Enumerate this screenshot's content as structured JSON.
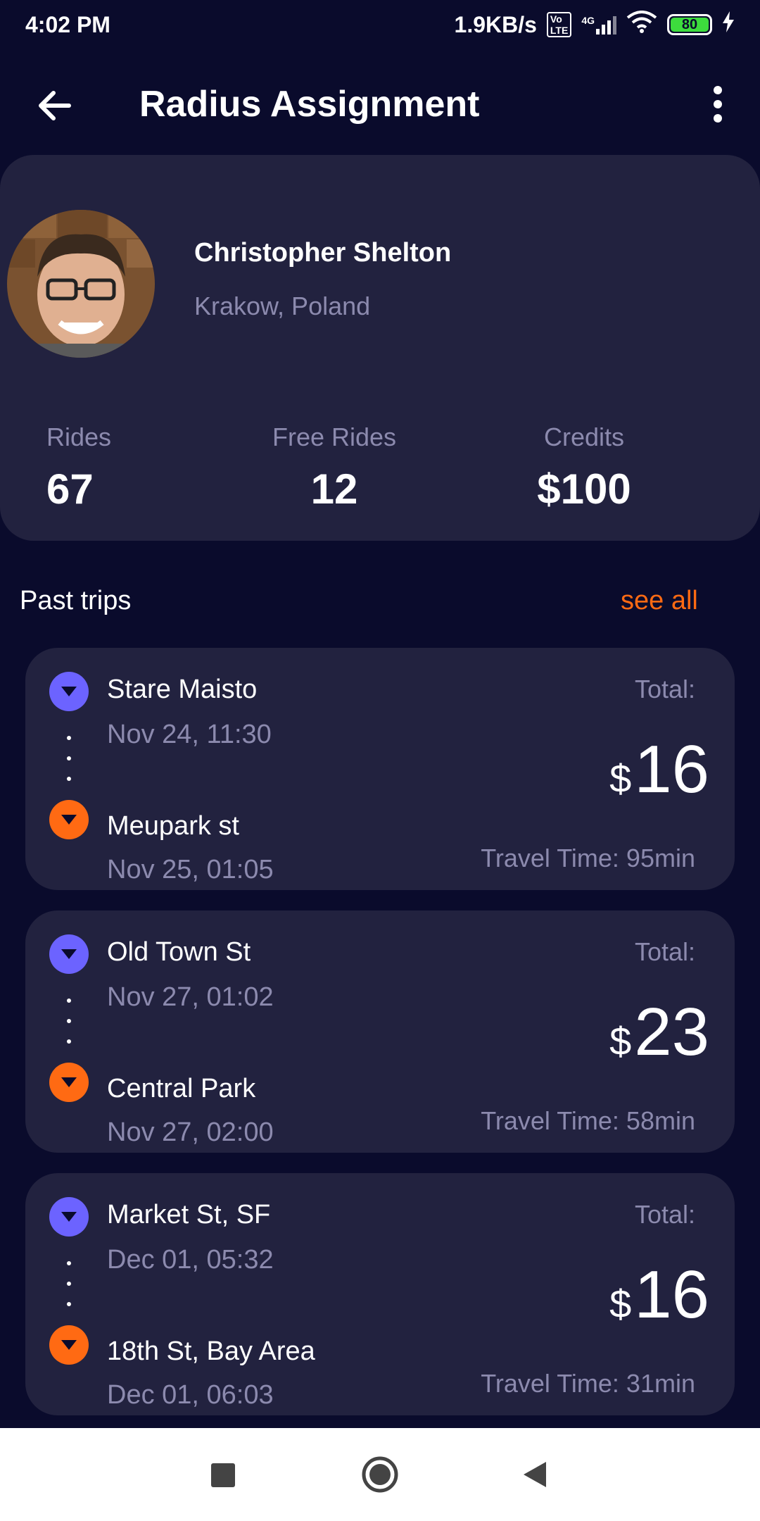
{
  "status_bar": {
    "time": "4:02 PM",
    "network_speed": "1.9KB/s",
    "volte": "Vo LTE",
    "network_type": "4G",
    "battery": "80",
    "icons": [
      "volte-icon",
      "signal-icon",
      "wifi-icon",
      "battery-icon",
      "charging-icon"
    ]
  },
  "header": {
    "title": "Radius Assignment",
    "back_icon": "arrow-left-icon",
    "more_icon": "more-vertical-icon"
  },
  "profile": {
    "name": "Christopher Shelton",
    "location": "Krakow, Poland",
    "stats": {
      "rides_label": "Rides",
      "rides_value": "67",
      "free_rides_label": "Free Rides",
      "free_rides_value": "12",
      "credits_label": "Credits",
      "credits_value": "$100"
    }
  },
  "trips_section": {
    "title": "Past trips",
    "see_all": "see all"
  },
  "trips": [
    {
      "from": "Stare Maisto",
      "from_time": "Nov 24, 11:30",
      "to": "Meupark st",
      "to_time": "Nov 25, 01:05",
      "total_label": "Total:",
      "currency": "$",
      "amount": "16",
      "travel_time": "Travel Time: 95min"
    },
    {
      "from": "Old Town St",
      "from_time": "Nov 27, 01:02",
      "to": "Central Park",
      "to_time": "Nov 27, 02:00",
      "total_label": "Total:",
      "currency": "$",
      "amount": "23",
      "travel_time": "Travel Time: 58min"
    },
    {
      "from": "Market St, SF",
      "from_time": "Dec 01, 05:32",
      "to": "18th St, Bay Area",
      "to_time": "Dec 01, 06:03",
      "total_label": "Total:",
      "currency": "$",
      "amount": "16",
      "travel_time": "Travel Time: 31min"
    }
  ],
  "colors": {
    "background": "#0a0b2c",
    "card": "#22223f",
    "accent_orange": "#ff6a13",
    "accent_purple": "#6c63ff",
    "muted_text": "#8c8aae"
  },
  "nav_bar": {
    "icons": [
      "recent-apps-icon",
      "home-icon",
      "back-icon"
    ]
  }
}
